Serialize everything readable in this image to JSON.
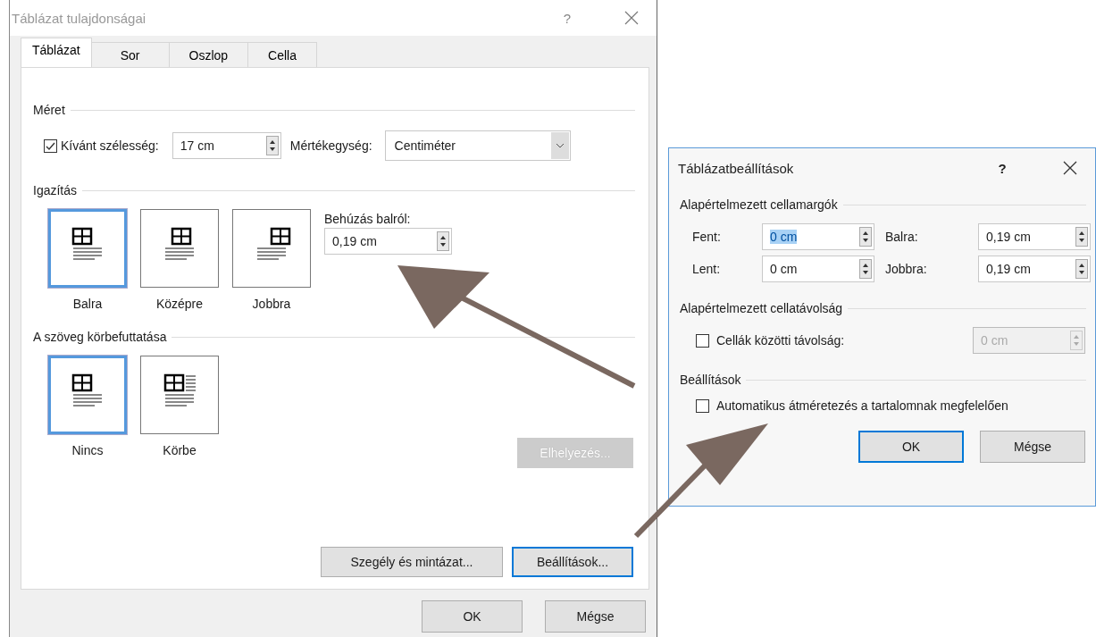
{
  "table_properties": {
    "title": "Táblázat tulajdonságai",
    "help": "?",
    "tabs": [
      {
        "label": "Táblázat",
        "selected": true
      },
      {
        "label": "Sor",
        "selected": false
      },
      {
        "label": "Oszlop",
        "selected": false
      },
      {
        "label": "Cella",
        "selected": false
      }
    ],
    "size": {
      "heading": "Méret",
      "preferred_width": {
        "label": "Kívánt szélesség:",
        "checked": true,
        "value": "17 cm"
      },
      "unit": {
        "label": "Mértékegység:",
        "value": "Centiméter"
      }
    },
    "alignment": {
      "heading": "Igazítás",
      "options": [
        {
          "label": "Balra",
          "kind": "left",
          "selected": true
        },
        {
          "label": "Középre",
          "kind": "center",
          "selected": false
        },
        {
          "label": "Jobbra",
          "kind": "right",
          "selected": false
        }
      ],
      "indent": {
        "label": "Behúzás balról:",
        "value": "0,19 cm"
      }
    },
    "wrapping": {
      "heading": "A szöveg körbefuttatása",
      "options": [
        {
          "label": "Nincs",
          "kind": "none",
          "selected": true
        },
        {
          "label": "Körbe",
          "kind": "around",
          "selected": false
        }
      ],
      "position_button": {
        "label": "Elhelyezés...",
        "disabled": true
      }
    },
    "panel_buttons": [
      {
        "label": "Szegély és mintázat...",
        "focused": false
      },
      {
        "label": "Beállítások...",
        "focused": true
      }
    ],
    "buttons": [
      {
        "label": "OK",
        "focused": false
      },
      {
        "label": "Mégse",
        "focused": false
      }
    ]
  },
  "table_options": {
    "title": "Táblázatbeállítások",
    "help": "?",
    "margins": {
      "heading": "Alapértelmezett cellamargók",
      "fields": [
        {
          "label": "Fent:",
          "value": "0 cm",
          "highlighted": true
        },
        {
          "label": "Balra:",
          "value": "0,19 cm",
          "highlighted": false
        },
        {
          "label": "Lent:",
          "value": "0 cm",
          "highlighted": false
        },
        {
          "label": "Jobbra:",
          "value": "0,19 cm",
          "highlighted": false
        }
      ]
    },
    "spacing": {
      "heading": "Alapértelmezett cellatávolság",
      "checkbox": {
        "label": "Cellák közötti távolság:",
        "checked": false
      },
      "field": {
        "value": "0 cm",
        "disabled": true
      }
    },
    "options": {
      "heading": "Beállítások",
      "checkbox": {
        "label": "Automatikus átméretezés a tartalomnak megfelelően",
        "checked": false
      }
    },
    "buttons": [
      {
        "label": "OK",
        "focused": true
      },
      {
        "label": "Mégse",
        "focused": false
      }
    ]
  }
}
